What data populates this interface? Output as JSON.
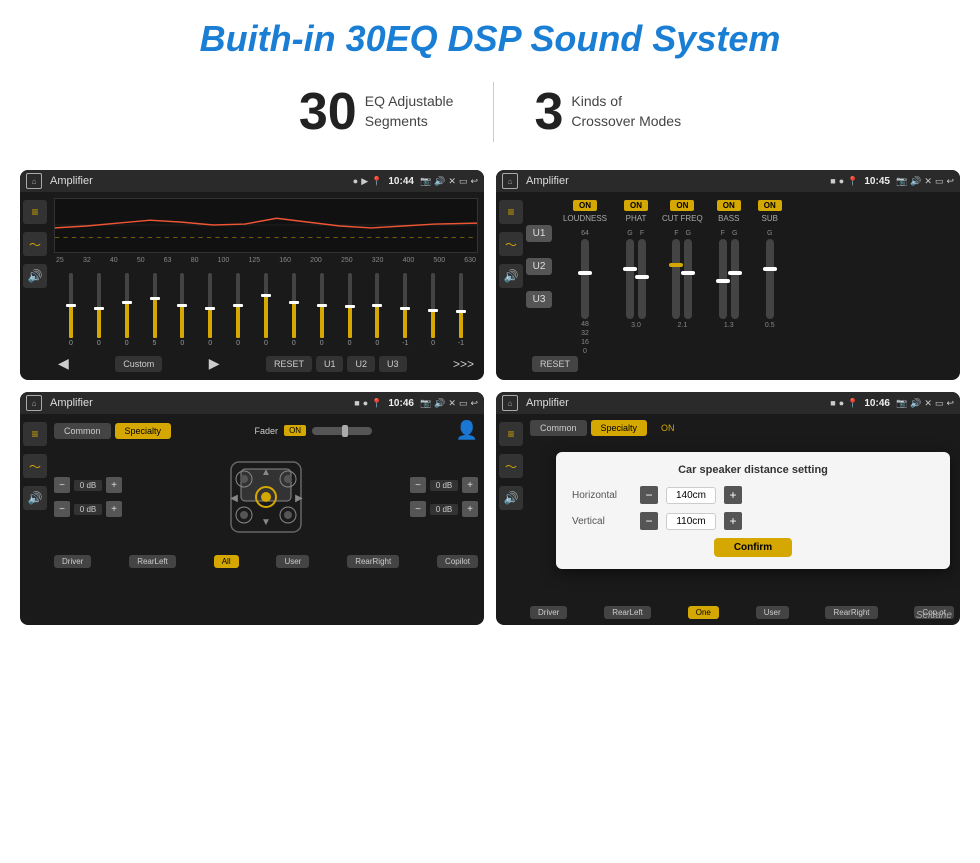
{
  "header": {
    "title": "Buith-in 30EQ DSP Sound System"
  },
  "stats": {
    "eq_number": "30",
    "eq_label_line1": "EQ Adjustable",
    "eq_label_line2": "Segments",
    "crossover_number": "3",
    "crossover_label_line1": "Kinds of",
    "crossover_label_line2": "Crossover Modes"
  },
  "screen1": {
    "title": "Amplifier",
    "time": "10:44",
    "freq_labels": [
      "25",
      "32",
      "40",
      "50",
      "63",
      "80",
      "100",
      "125",
      "160",
      "200",
      "250",
      "320",
      "400",
      "500",
      "630"
    ],
    "sliders": [
      50,
      40,
      45,
      55,
      60,
      50,
      45,
      65,
      55,
      50,
      48,
      52,
      45,
      40,
      38
    ],
    "bottom_btns": [
      "RESET",
      "U1",
      "U2",
      "U3"
    ],
    "preset_label": "Custom"
  },
  "screen2": {
    "title": "Amplifier",
    "time": "10:45",
    "u_buttons": [
      "U1",
      "U2",
      "U3"
    ],
    "columns": [
      {
        "on": true,
        "label": "LOUDNESS"
      },
      {
        "on": true,
        "label": "PHAT"
      },
      {
        "on": true,
        "label": "CUT FREQ"
      },
      {
        "on": true,
        "label": "BASS"
      },
      {
        "on": true,
        "label": "SUB"
      }
    ],
    "reset_label": "RESET"
  },
  "screen3": {
    "title": "Amplifier",
    "time": "10:46",
    "tabs": [
      "Common",
      "Specialty"
    ],
    "active_tab": "Specialty",
    "fader_label": "Fader",
    "fader_on": "ON",
    "db_values": [
      "0 dB",
      "0 dB",
      "0 dB",
      "0 dB"
    ],
    "bottom_btns": [
      "Driver",
      "RearLeft",
      "All",
      "User",
      "RearRight",
      "Copilot"
    ]
  },
  "screen4": {
    "title": "Amplifier",
    "time": "10:46",
    "tabs": [
      "Common",
      "Specialty"
    ],
    "active_tab": "Specialty",
    "dialog_title": "Car speaker distance setting",
    "horizontal_label": "Horizontal",
    "horizontal_value": "140cm",
    "vertical_label": "Vertical",
    "vertical_value": "110cm",
    "confirm_label": "Confirm",
    "bottom_btns": [
      "Driver",
      "RearLeft",
      "User",
      "RearRight",
      "Copilot"
    ],
    "bottom_labels": {
      "one": "One",
      "copilot": "Cop ot"
    }
  },
  "watermark": "Seicane"
}
